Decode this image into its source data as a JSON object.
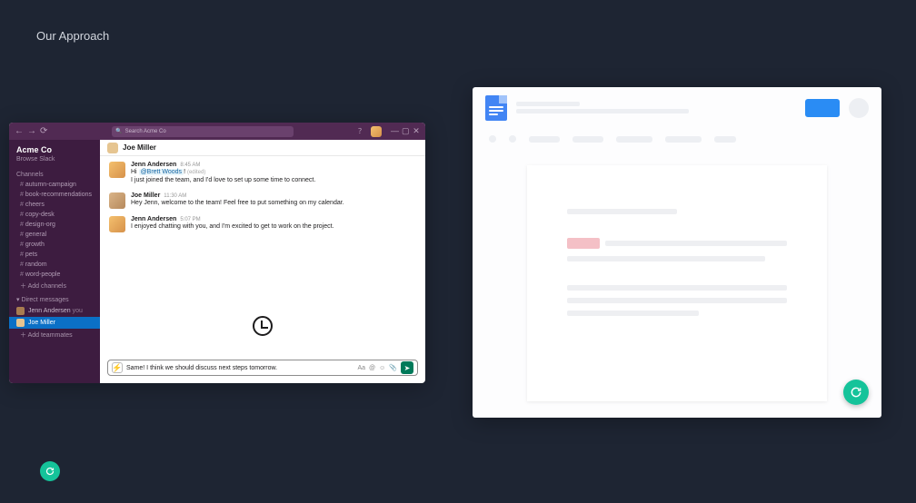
{
  "page": {
    "title": "Our Approach"
  },
  "slack": {
    "search_placeholder": "Search Acme Co",
    "window_controls": {
      "min": "—",
      "max": "▢",
      "close": "✕"
    },
    "workspace": "Acme Co",
    "browse": "Browse Slack",
    "channels_label": "Channels",
    "channels": [
      "autumn-campaign",
      "book-recommendations",
      "cheers",
      "copy-desk",
      "design-org",
      "general",
      "growth",
      "pets",
      "random",
      "word-people"
    ],
    "add_channels": "Add channels",
    "dm_label": "Direct messages",
    "dms": [
      {
        "name": "Jenn Andersen",
        "suffix": "you"
      },
      {
        "name": "Joe Miller",
        "suffix": ""
      }
    ],
    "add_teammates": "Add teammates",
    "main_header": "Joe Miller",
    "messages": [
      {
        "author": "Jenn Andersen",
        "time": "8:45 AM",
        "avatar": "av1",
        "lines": [
          {
            "plain": "Hi ",
            "mention": "@Brett Woods",
            "tail": "!",
            "edited": true
          },
          {
            "plain": "I just joined the team, and I'd love to set up some time to connect."
          }
        ]
      },
      {
        "author": "Joe Miller",
        "time": "11:30 AM",
        "avatar": "av2",
        "lines": [
          {
            "plain": "Hey Jenn, welcome to the team!  Feel free to put something on my calendar."
          }
        ]
      },
      {
        "author": "Jenn Andersen",
        "time": "5:07 PM",
        "avatar": "av1",
        "lines": [
          {
            "plain": "I enjoyed chatting with you, and I'm excited to get to work on the project."
          }
        ]
      }
    ],
    "composer": {
      "text": "Same! I think we should discuss next steps tomorrow.",
      "icons": {
        "format": "Aa",
        "at": "@",
        "emoji": "☺",
        "attach": "📎",
        "send": "➤"
      }
    }
  },
  "docs": {}
}
